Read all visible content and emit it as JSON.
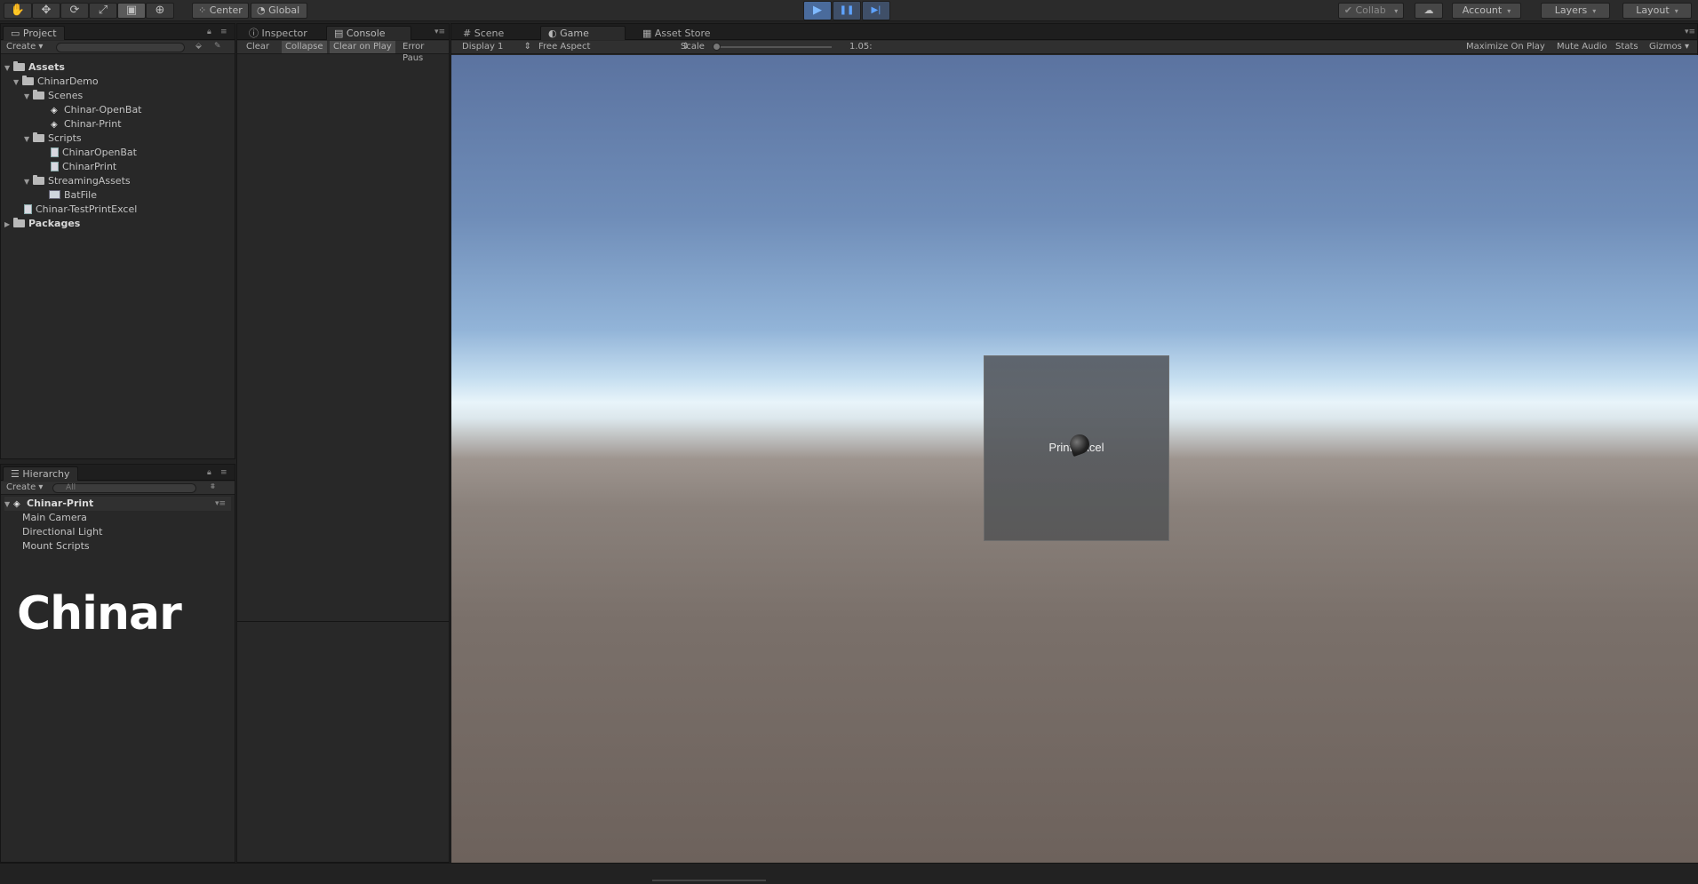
{
  "toolbar": {
    "tools": [
      {
        "name": "hand-tool",
        "glyph": "✋"
      },
      {
        "name": "move-tool",
        "glyph": "✥"
      },
      {
        "name": "rotate-tool",
        "glyph": "⟳"
      },
      {
        "name": "scale-tool",
        "glyph": "⤢"
      },
      {
        "name": "rect-tool",
        "glyph": "▣"
      },
      {
        "name": "transform-tool",
        "glyph": "⊕"
      }
    ],
    "pivot": "Center",
    "space": "Global",
    "play_icon": "▶",
    "pause_icon": "❚❚",
    "step_icon": "▶|",
    "collab": "Collab",
    "cloud_icon": "☁",
    "account": "Account",
    "layers": "Layers",
    "layout": "Layout"
  },
  "project": {
    "tab": "Project",
    "create": "Create",
    "tree": [
      {
        "label": "Assets",
        "bold": true
      },
      {
        "label": "ChinarDemo"
      },
      {
        "label": "Scenes"
      },
      {
        "label": "Chinar-OpenBat"
      },
      {
        "label": "Chinar-Print"
      },
      {
        "label": "Scripts"
      },
      {
        "label": "ChinarOpenBat"
      },
      {
        "label": "ChinarPrint"
      },
      {
        "label": "StreamingAssets"
      },
      {
        "label": "BatFile"
      },
      {
        "label": "Chinar-TestPrintExcel"
      },
      {
        "label": "Packages",
        "bold": true
      }
    ]
  },
  "hierarchy": {
    "tab": "Hierarchy",
    "create": "Create",
    "search_placeholder": "All",
    "scene": "Chinar-Print",
    "items": [
      "Main Camera",
      "Directional Light",
      "Mount Scripts"
    ]
  },
  "middle": {
    "tabs": [
      "Inspector",
      "Console"
    ],
    "console_buttons": [
      "Clear",
      "Collapse",
      "Clear on Play",
      "Error Paus"
    ]
  },
  "right": {
    "tabs": [
      "Scene",
      "Game",
      "Asset Store"
    ],
    "display": "Display 1",
    "aspect": "Free Aspect",
    "scale_label": "Scale",
    "scale_value": "1.05:",
    "maximize": "Maximize On Play",
    "mute": "Mute Audio",
    "stats": "Stats",
    "gizmos": "Gizmos"
  },
  "game": {
    "button_text": "Print Excel"
  },
  "watermark": "Chinar"
}
